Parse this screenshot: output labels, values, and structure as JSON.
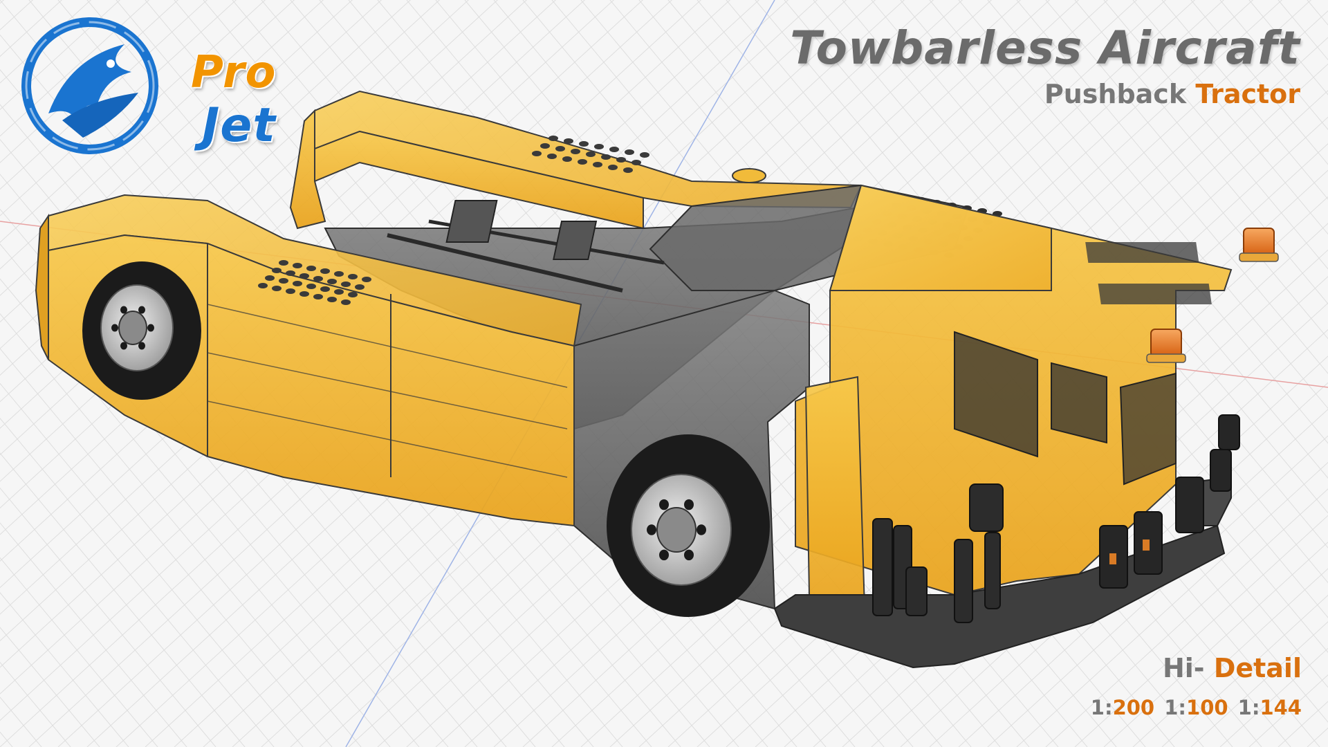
{
  "branding": {
    "logo_word_1": "Pro",
    "logo_word_2": "Jet",
    "logo_colors": {
      "blue": "#1a74d0",
      "orange": "#f29400"
    }
  },
  "header": {
    "title": "Towbarless Aircraft",
    "subtitle_part_1": "Pushback",
    "subtitle_part_2": "Tractor"
  },
  "footer": {
    "detail_part_1": "Hi-",
    "detail_part_2": "Detail",
    "scales": [
      {
        "prefix": "1:",
        "value": "200"
      },
      {
        "prefix": "1:",
        "value": "100"
      },
      {
        "prefix": "1:",
        "value": "144"
      }
    ]
  },
  "colors": {
    "body": "#f2b12a",
    "body_dark": "#c98a12",
    "chassis": "#5a5a5a",
    "tire": "#1b1b1b",
    "rim": "#cfcfcf",
    "beacon": "#e8761c",
    "grid_line": "#dedede",
    "axis_red": "#e7a0a0",
    "axis_blue": "#9fb4e6",
    "accent_text": "#d9700e",
    "title_text": "#6b6b6b"
  }
}
